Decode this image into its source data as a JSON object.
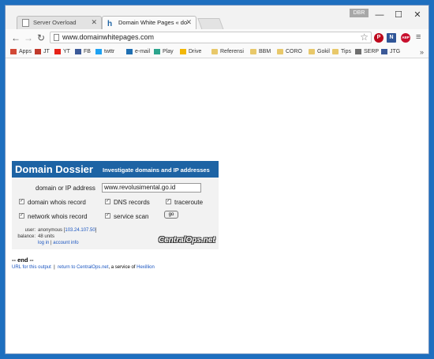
{
  "browser": {
    "tabs": [
      {
        "label": "Server Overload",
        "active": false
      },
      {
        "label": "Domain White Pages « do",
        "active": true
      }
    ],
    "user_badge": "DBR",
    "window_controls": {
      "minimize": "—",
      "maximize": "☐",
      "close": "✕"
    },
    "url": "www.domainwhitepages.com",
    "extensions": [
      {
        "icon": "pinterest-icon",
        "glyph": "P",
        "color": "#bd081c"
      },
      {
        "icon": "notepad-icon",
        "glyph": "N",
        "color": "#2f5597"
      },
      {
        "icon": "adblock-icon",
        "glyph": "ABP",
        "color": "#c8102e"
      }
    ]
  },
  "bookmarks": [
    {
      "label": "Apps",
      "icon": "apps-icon",
      "color": "#d14836"
    },
    {
      "label": "JT",
      "icon": "jt-icon",
      "color": "#c0392b"
    },
    {
      "label": "YT",
      "icon": "youtube-icon",
      "color": "#e62117"
    },
    {
      "label": "FB",
      "icon": "facebook-icon",
      "color": "#3b5998"
    },
    {
      "label": "twttr",
      "icon": "twitter-icon",
      "color": "#1da1f2"
    },
    {
      "label": "e-mail",
      "icon": "zoho-icon",
      "color": "#1f6fb2"
    },
    {
      "label": "Play",
      "icon": "play-icon",
      "color": "#2ca58d"
    },
    {
      "label": "Drive",
      "icon": "drive-icon",
      "color": "#f2b705"
    },
    {
      "label": "Referensi",
      "icon": "folder-icon",
      "color": "#e8c86a"
    },
    {
      "label": "BBM",
      "icon": "folder-icon",
      "color": "#e8c86a"
    },
    {
      "label": "CORO",
      "icon": "folder-icon",
      "color": "#e8c86a"
    },
    {
      "label": "Gokil",
      "icon": "folder-icon",
      "color": "#e8c86a"
    },
    {
      "label": "Tips",
      "icon": "folder-icon",
      "color": "#e8c86a"
    },
    {
      "label": "SERP",
      "icon": "serp-icon",
      "color": "#6e6e6e"
    },
    {
      "label": "JTG",
      "icon": "facebook-icon",
      "color": "#3b5998"
    }
  ],
  "dossier": {
    "title": "Domain Dossier",
    "subtitle": "Investigate domains and IP addresses",
    "domain_label": "domain or IP address",
    "domain_value": "www.revolusimental.go.id",
    "options": [
      {
        "label": "domain whois record",
        "checked": true
      },
      {
        "label": "DNS records",
        "checked": true
      },
      {
        "label": "traceroute",
        "checked": true
      },
      {
        "label": "network whois record",
        "checked": true
      },
      {
        "label": "service scan",
        "checked": true
      }
    ],
    "go_label": "go",
    "user_label": "user:",
    "user_value": "anonymous [",
    "user_ip": "103.24.107.50",
    "user_suffix": "]",
    "balance_label": "balance:",
    "balance_value": "48 units",
    "login_link": "log in",
    "separator": "|",
    "account_link": "account info",
    "logo": "CentralOps.net"
  },
  "end_text": "-- end --",
  "footer": {
    "url_link": "URL for this output",
    "sep": "|",
    "return_link": "return to CentralOps.net",
    "middle_text": ", a service of",
    "hexillion_link": "Hexillion"
  }
}
